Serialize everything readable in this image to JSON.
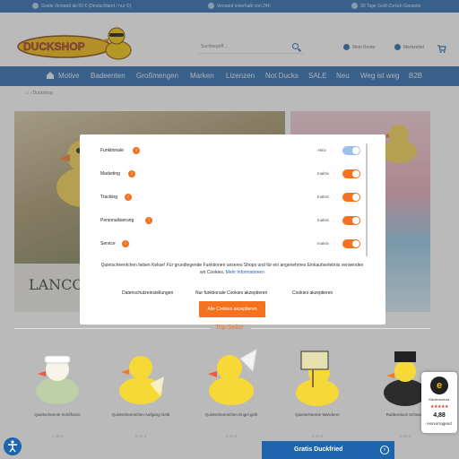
{
  "topbar": {
    "items": [
      "Gratis Versand ab 50 € (Deutschland / nur ©)",
      "Versand innerhalb von 24h",
      "30 Tage Geld-Zurück-Garantie"
    ]
  },
  "header": {
    "logo_text": "DUCKSHOP",
    "search_placeholder": "Suchbegriff...",
    "account_label": "Mein Konto",
    "wishlist_label": "Merkzettel"
  },
  "nav": {
    "items": [
      "Motive",
      "Badeenten",
      "Großmengen",
      "Marken",
      "Lizenzen",
      "Not Ducks",
      "SALE",
      "Neu",
      "Weg ist weg",
      "B2B"
    ]
  },
  "breadcrumb": {
    "current": "Duckshop"
  },
  "banner": {
    "left_text": "LANCO D"
  },
  "cookie_modal": {
    "categories": [
      {
        "label": "Funktionale",
        "status": "Aktiv",
        "enabled": true
      },
      {
        "label": "Marketing",
        "status": "Inaktiv",
        "enabled": false
      },
      {
        "label": "Tracking",
        "status": "Inaktiv",
        "enabled": false
      },
      {
        "label": "Personalisierung",
        "status": "Inaktiv",
        "enabled": false
      },
      {
        "label": "Service",
        "status": "Inaktiv",
        "enabled": false
      }
    ],
    "text": "Quietscheentchen lieben Kekse! Für grundlegende Funktionen unseres Shops und für ein angenehmes Einkaufserlebnis verwenden wir Cookies.",
    "more_info": "Mehr Informationen",
    "btn_settings": "Datenschutzeinstellungen",
    "btn_functional": "Nur funktionale Cookies akzeptieren",
    "btn_accept": "Cookies akzeptieren",
    "btn_accept_all": "Alle Cookies akzeptieren",
    "info_glyph": "i"
  },
  "top_seller": {
    "title": "Top-Seller",
    "products": [
      {
        "name": "Quietscheente Schiffsarzt",
        "price": "5,49 €"
      },
      {
        "name": "Quietscheentchen Aufgang Gelb",
        "price": "5,99 €"
      },
      {
        "name": "Quietscheentchen Engel gelb",
        "price": "5,99 €"
      },
      {
        "name": "Quietscheente Wanderer",
        "price": "5,99 €"
      },
      {
        "name": "Rubberduck Schwarz",
        "price": "5,99 €"
      }
    ]
  },
  "gratis_bar": {
    "label": "Gratis Duckfried",
    "glyph": "›"
  },
  "trust_badge": {
    "seal": "e",
    "title": "Käuferschutz",
    "stars": "★★★★★",
    "rating": "4,88",
    "label": "Hervorragend"
  },
  "colors": {
    "brand_blue": "#1f65ad",
    "accent_orange": "#f4711f",
    "toggle_on": "#9cc0eb"
  }
}
